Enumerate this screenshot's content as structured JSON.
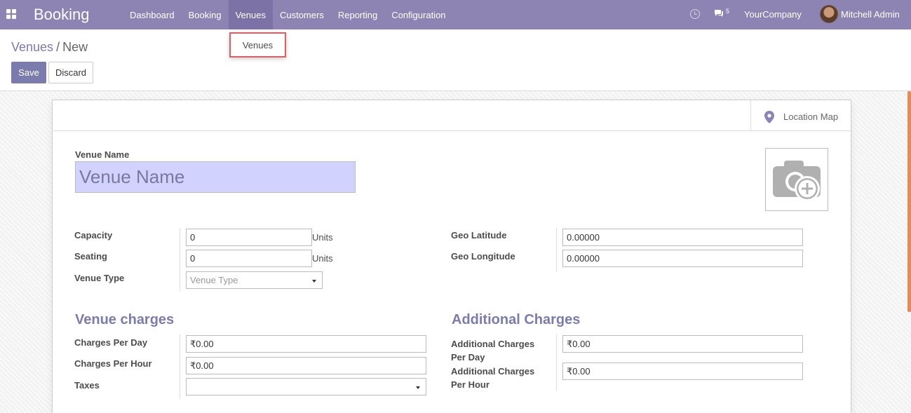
{
  "navbar": {
    "brand": "Booking",
    "menu": [
      "Dashboard",
      "Booking",
      "Venues",
      "Customers",
      "Reporting",
      "Configuration"
    ],
    "chat_count": "5",
    "company": "YourCompany",
    "user": "Mitchell Admin"
  },
  "dropdown": {
    "item": "Venues"
  },
  "breadcrumb": {
    "parent": "Venues",
    "separator": "/",
    "current": "New"
  },
  "buttons": {
    "save": "Save",
    "discard": "Discard"
  },
  "sheet": {
    "location_map": "Location Map",
    "venue_name_label": "Venue Name",
    "venue_name_placeholder": "Venue Name",
    "capacity_label": "Capacity",
    "capacity_value": "0",
    "capacity_unit": "Units",
    "seating_label": "Seating",
    "seating_value": "0",
    "seating_unit": "Units",
    "venue_type_label": "Venue Type",
    "venue_type_placeholder": "Venue Type",
    "geo_lat_label": "Geo Latitude",
    "geo_lat_value": "0.00000",
    "geo_lng_label": "Geo Longitude",
    "geo_lng_value": "0.00000",
    "venue_charges_title": "Venue charges",
    "charges_day_label": "Charges Per Day",
    "charges_day_value": "₹0.00",
    "charges_hour_label": "Charges Per Hour",
    "charges_hour_value": "₹0.00",
    "taxes_label": "Taxes",
    "additional_title": "Additional Charges",
    "add_day_label_1": "Additional Charges",
    "add_day_label_2": "Per Day",
    "add_day_value": "₹0.00",
    "add_hour_label_1": "Additional Charges",
    "add_hour_label_2": "Per Hour",
    "add_hour_value": "₹0.00"
  },
  "colors": {
    "navbar": "#8e84b4",
    "primary": "#7c7bad",
    "input_highlight": "#d2d2ff",
    "dropdown_border": "#e05d66"
  }
}
